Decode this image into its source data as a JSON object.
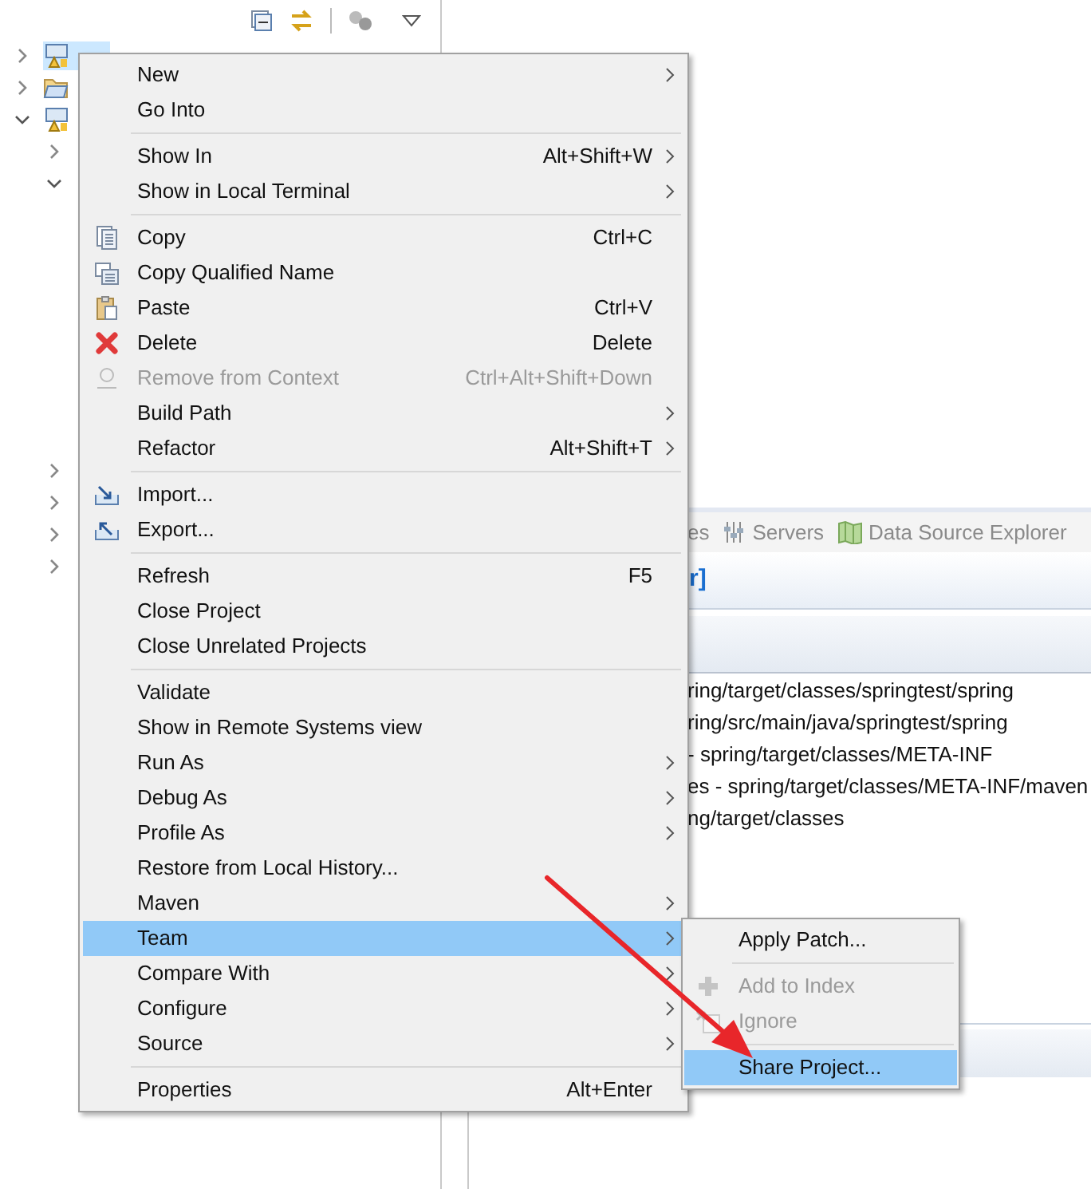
{
  "explorer": {
    "tree": [
      {
        "kind": "project",
        "expanded": false,
        "selected": true
      },
      {
        "kind": "folder",
        "expanded": false,
        "selected": false
      },
      {
        "kind": "project",
        "expanded": true,
        "selected": false,
        "children": [
          {
            "expanded": false
          },
          {
            "expanded": true
          },
          {
            "expanded": false
          },
          {
            "expanded": false
          },
          {
            "expanded": false
          },
          {
            "expanded": false
          }
        ]
      }
    ]
  },
  "bottom_panel": {
    "tabs": [
      {
        "label": "es",
        "kind": "plain"
      },
      {
        "label": "Servers",
        "kind": "servers"
      },
      {
        "label": "Data Source Explorer",
        "kind": "datasource"
      }
    ],
    "title": "r]",
    "rows": [
      "ring/target/classes/springtest/spring",
      "ring/src/main/java/springtest/spring",
      "- spring/target/classes/META-INF",
      "es - spring/target/classes/META-INF/maven",
      "ng/target/classes"
    ]
  },
  "context_menu": {
    "sections": [
      [
        {
          "label": "New",
          "submenu": true,
          "disabled": false,
          "selected": false,
          "kind": "plain"
        },
        {
          "label": "Go Into",
          "submenu": false,
          "disabled": false,
          "selected": false,
          "kind": "plain"
        }
      ],
      [
        {
          "label": "Show In",
          "shortcut": "Alt+Shift+W",
          "submenu": true,
          "disabled": false,
          "selected": false,
          "kind": "plain"
        },
        {
          "label": "Show in Local Terminal",
          "submenu": true,
          "disabled": false,
          "selected": false,
          "kind": "plain"
        }
      ],
      [
        {
          "label": "Copy",
          "shortcut": "Ctrl+C",
          "submenu": false,
          "disabled": false,
          "selected": false,
          "kind": "copy"
        },
        {
          "label": "Copy Qualified Name",
          "submenu": false,
          "disabled": false,
          "selected": false,
          "kind": "copyname"
        },
        {
          "label": "Paste",
          "shortcut": "Ctrl+V",
          "submenu": false,
          "disabled": false,
          "selected": false,
          "kind": "paste"
        },
        {
          "label": "Delete",
          "shortcut": "Delete",
          "submenu": false,
          "disabled": false,
          "selected": false,
          "kind": "delete"
        },
        {
          "label": "Remove from Context",
          "shortcut": "Ctrl+Alt+Shift+Down",
          "submenu": false,
          "disabled": true,
          "selected": false,
          "kind": "remove"
        },
        {
          "label": "Build Path",
          "submenu": true,
          "disabled": false,
          "selected": false,
          "kind": "plain"
        },
        {
          "label": "Refactor",
          "shortcut": "Alt+Shift+T",
          "submenu": true,
          "disabled": false,
          "selected": false,
          "kind": "plain"
        }
      ],
      [
        {
          "label": "Import...",
          "submenu": false,
          "disabled": false,
          "selected": false,
          "kind": "import"
        },
        {
          "label": "Export...",
          "submenu": false,
          "disabled": false,
          "selected": false,
          "kind": "export"
        }
      ],
      [
        {
          "label": "Refresh",
          "shortcut": "F5",
          "submenu": false,
          "disabled": false,
          "selected": false,
          "kind": "plain"
        },
        {
          "label": "Close Project",
          "submenu": false,
          "disabled": false,
          "selected": false,
          "kind": "plain"
        },
        {
          "label": "Close Unrelated Projects",
          "submenu": false,
          "disabled": false,
          "selected": false,
          "kind": "plain"
        }
      ],
      [
        {
          "label": "Validate",
          "submenu": false,
          "disabled": false,
          "selected": false,
          "kind": "plain"
        },
        {
          "label": "Show in Remote Systems view",
          "submenu": false,
          "disabled": false,
          "selected": false,
          "kind": "plain"
        },
        {
          "label": "Run As",
          "submenu": true,
          "disabled": false,
          "selected": false,
          "kind": "plain"
        },
        {
          "label": "Debug As",
          "submenu": true,
          "disabled": false,
          "selected": false,
          "kind": "plain"
        },
        {
          "label": "Profile As",
          "submenu": true,
          "disabled": false,
          "selected": false,
          "kind": "plain"
        },
        {
          "label": "Restore from Local History...",
          "submenu": false,
          "disabled": false,
          "selected": false,
          "kind": "plain"
        },
        {
          "label": "Maven",
          "submenu": true,
          "disabled": false,
          "selected": false,
          "kind": "plain"
        },
        {
          "label": "Team",
          "submenu": true,
          "disabled": false,
          "selected": true,
          "kind": "plain"
        },
        {
          "label": "Compare With",
          "submenu": true,
          "disabled": false,
          "selected": false,
          "kind": "plain"
        },
        {
          "label": "Configure",
          "submenu": true,
          "disabled": false,
          "selected": false,
          "kind": "plain"
        },
        {
          "label": "Source",
          "submenu": true,
          "disabled": false,
          "selected": false,
          "kind": "plain"
        }
      ],
      [
        {
          "label": "Properties",
          "shortcut": "Alt+Enter",
          "submenu": false,
          "disabled": false,
          "selected": false,
          "kind": "plain"
        }
      ]
    ]
  },
  "submenu": {
    "sections": [
      [
        {
          "label": "Apply Patch...",
          "submenu": false,
          "disabled": false,
          "selected": false,
          "kind": "plain"
        }
      ],
      [
        {
          "label": "Add to Index",
          "submenu": false,
          "disabled": true,
          "selected": false,
          "kind": "plus"
        },
        {
          "label": "Ignore",
          "submenu": false,
          "disabled": true,
          "selected": false,
          "kind": "ignore"
        }
      ],
      [
        {
          "label": "Share Project...",
          "submenu": false,
          "disabled": false,
          "selected": true,
          "kind": "plain"
        }
      ]
    ]
  }
}
